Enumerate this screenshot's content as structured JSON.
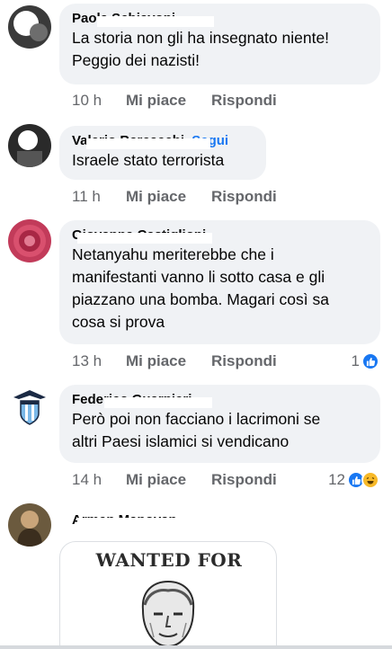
{
  "comments": [
    {
      "author": "Paola Schiavoni",
      "text": "La storia non gli ha insegnato niente!\nPeggio dei nazisti!",
      "time": "10 h",
      "like_label": "Mi piace",
      "reply_label": "Rispondi",
      "reaction_count": ""
    },
    {
      "author": "Valerio Barcacchi",
      "tag": "Segui",
      "text": "Israele stato terrorista",
      "time": "11 h",
      "like_label": "Mi piace",
      "reply_label": "Rispondi",
      "reaction_count": ""
    },
    {
      "author": "Giovanna Castiglioni",
      "text": "Netanyahu meriterebbe che i\nmanifestanti vanno li sotto casa e gli\npiazzano una bomba. Magari così sa\ncosa si prova",
      "time": "13 h",
      "like_label": "Mi piace",
      "reply_label": "Rispondi",
      "reaction_count": "1"
    },
    {
      "author": "Federico Guarnieri",
      "text": "Però poi non facciano i lacrimoni se\naltri Paesi islamici si vendicano",
      "time": "14 h",
      "like_label": "Mi piace",
      "reply_label": "Rispondi",
      "reaction_count": "12"
    },
    {
      "author": "Armen Manoyan",
      "attachment_title": "WANTED FOR"
    }
  ],
  "colors": {
    "bubble": "#f0f2f5",
    "meta": "#65676b",
    "link": "#1877f2",
    "like_reaction": "#1877f2",
    "haha_reaction": "#f7b928"
  },
  "icons": {
    "like_reaction": "thumbs-up-icon",
    "haha_reaction": "laughing-face-icon",
    "lazio_logo": "eagle-shield-icon"
  }
}
